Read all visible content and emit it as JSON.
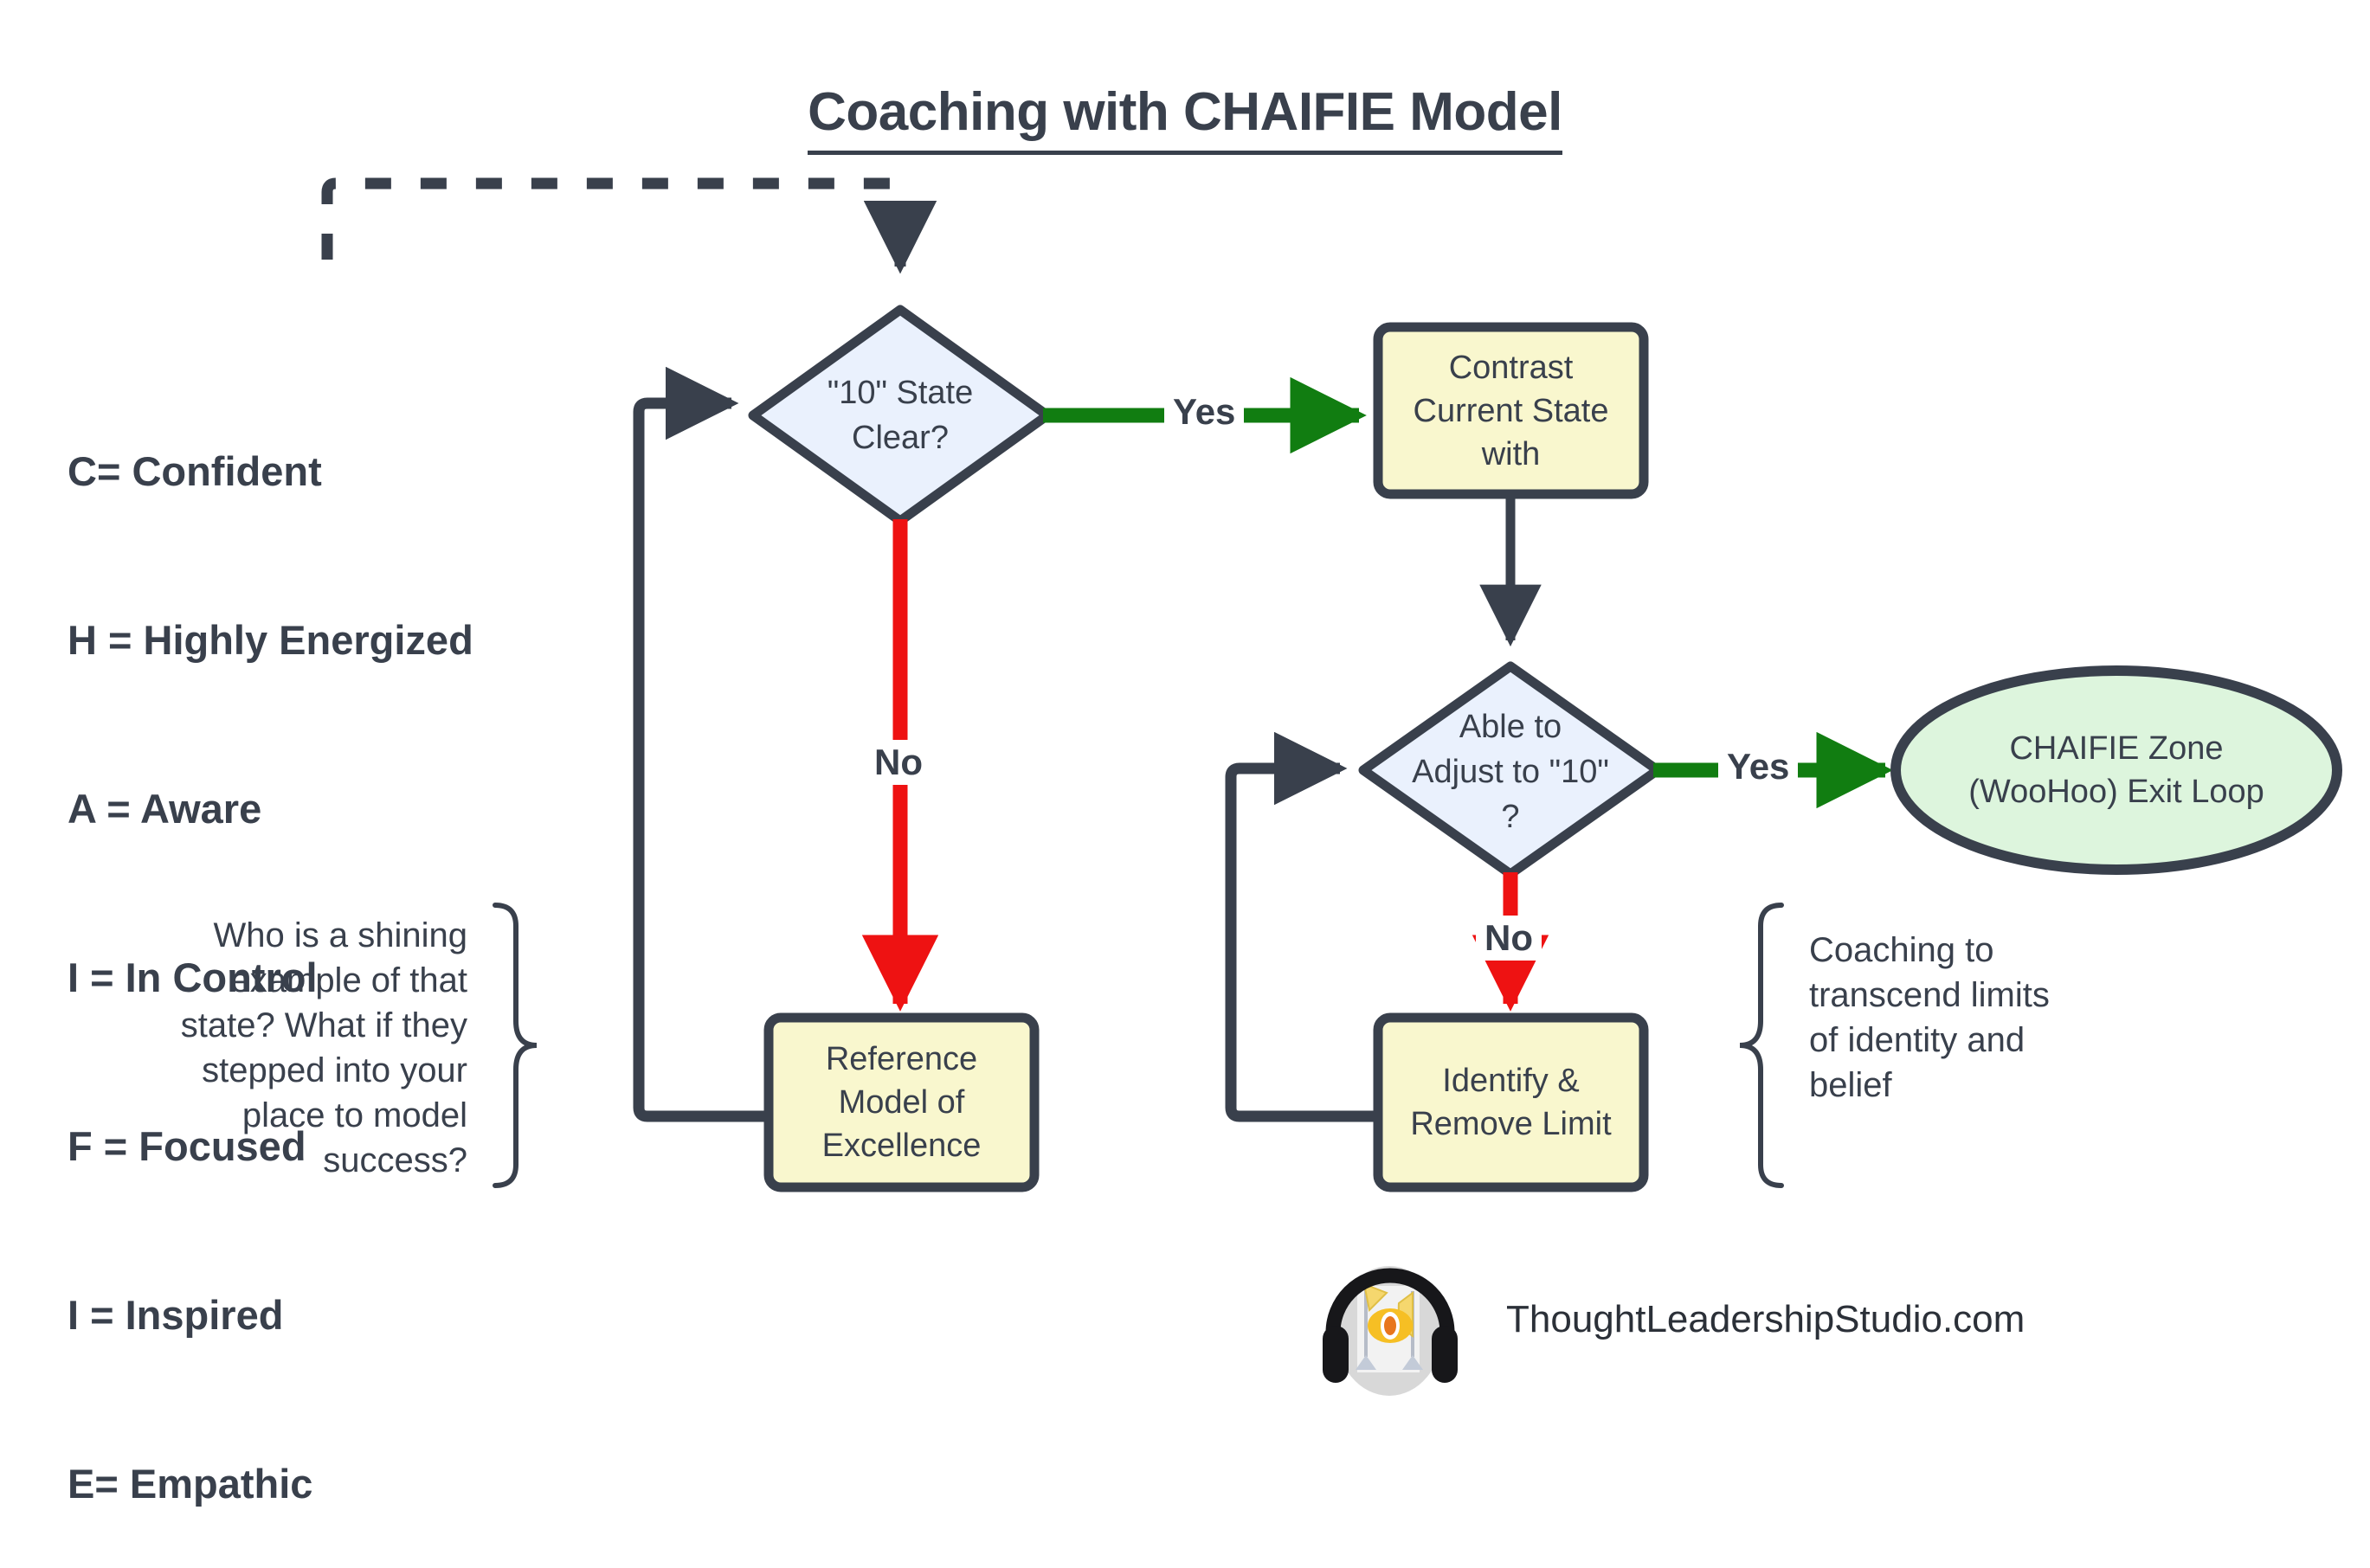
{
  "title": "Coaching with CHAIFIE Model",
  "legend": {
    "name": "chaifie-acronym",
    "items": [
      "C= Confident",
      "H = Highly Energized",
      "A = Aware",
      "I = In Control",
      "F = Focused",
      "I = Inspired",
      "E= Empathic"
    ]
  },
  "nodes": {
    "decision_state_clear": "\"10\"  State\nClear?",
    "process_contrast": "Contrast\nCurrent State\nwith",
    "process_reference_model": "Reference\nModel of\nExcellence",
    "decision_adjust": "Able to\nAdjust to  \"10\"\n?",
    "process_identify_remove": "Identify &\nRemove Limit",
    "terminal_chaifie_zone": "CHAIFIE Zone\n(WooHoo) Exit Loop"
  },
  "edges": {
    "yes_1": "Yes",
    "no_1": "No",
    "yes_2": "Yes",
    "no_2": "No"
  },
  "annotations": {
    "left": "Who is a shining example of that state? What if they stepped into your place to model success?",
    "right": "Coaching to transcend limits of identity and belief"
  },
  "footer": {
    "site": "ThoughtLeadershipStudio.com",
    "logo_icon": "headphones-studio-eye-logo"
  },
  "colors": {
    "ink": "#39404c",
    "decision_fill": "#eaf1fd",
    "process_fill": "#f9f7ce",
    "terminal_fill": "#ddf5dd",
    "yes_green": "#117d11",
    "no_red": "#ee1212",
    "background": "#ffffff"
  }
}
